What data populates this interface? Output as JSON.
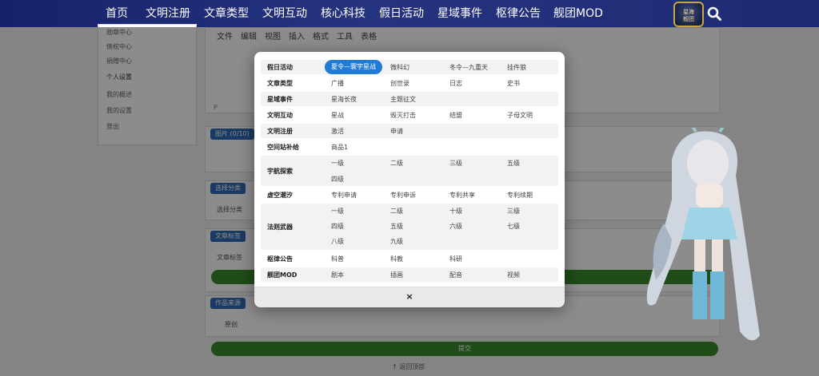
{
  "nav": {
    "items": [
      "首页",
      "文明注册",
      "文章类型",
      "文明互动",
      "核心科技",
      "假日活动",
      "星域事件",
      "枢律公告",
      "舰团MOD"
    ],
    "logo_text": "星海\n舰团"
  },
  "background": {
    "menu": [
      "勋章中心",
      "债权中心",
      "捐赠中心",
      "个人设置",
      "我的概述",
      "我的设置",
      "登出"
    ],
    "editor_toolbar": [
      "文件",
      "编辑",
      "视图",
      "插入",
      "格式",
      "工具",
      "表格"
    ],
    "editor_status": "P",
    "sections": [
      "图片 (0/10)",
      "选择分类",
      "选择分类",
      "文章标签",
      "文章标签",
      "作品来源",
      "原创"
    ],
    "submit_label": "提交",
    "back_top": "返回顶部"
  },
  "modal": {
    "rows": [
      {
        "category": "假日活动",
        "options": [
          "夏令—寰宇星战",
          "微科幻",
          "冬令—九重天",
          "挂件狼"
        ],
        "active": 0
      },
      {
        "category": "文章类型",
        "options": [
          "广播",
          "创世录",
          "日志",
          "史书"
        ]
      },
      {
        "category": "星域事件",
        "options": [
          "星海长夜",
          "主题征文"
        ]
      },
      {
        "category": "文明互动",
        "options": [
          "星战",
          "毁灭打击",
          "结盟",
          "子母文明"
        ]
      },
      {
        "category": "文明注册",
        "options": [
          "激活",
          "申请"
        ]
      },
      {
        "category": "空间站补给",
        "options": [
          "商品1"
        ]
      },
      {
        "category": "宇航探索",
        "options": [
          "一级",
          "二级",
          "三级",
          "五级",
          "四级"
        ]
      },
      {
        "category": "虚空潮汐",
        "options": [
          "专利申请",
          "专利申诉",
          "专利共享",
          "专利续期"
        ]
      },
      {
        "category": "法则武器",
        "options": [
          "一级",
          "二级",
          "十级",
          "三级",
          "四级",
          "五级",
          "六级",
          "七级",
          "八级",
          "九级"
        ]
      },
      {
        "category": "枢律公告",
        "options": [
          "科普",
          "科教",
          "科研"
        ]
      },
      {
        "category": "舰团MOD",
        "options": [
          "剧本",
          "插画",
          "配音",
          "视频"
        ]
      }
    ],
    "close_label": "×"
  },
  "colors": {
    "nav_bg": "#1e2a73",
    "accent": "#1f7bd6",
    "submit": "#3a8a2a"
  }
}
